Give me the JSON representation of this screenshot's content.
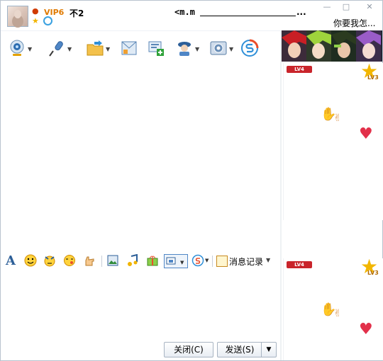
{
  "header": {
    "vip_label": "VIP6",
    "nickname": "不2",
    "remark_prefix": "<m.m",
    "remark_suffix": "...",
    "status_text": "你要我怎..."
  },
  "window_controls": [
    "—",
    "□",
    "✕"
  ],
  "toolbar": {
    "buttons": [
      {
        "name": "video-call",
        "icon": "webcam-icon",
        "has_dropdown": true
      },
      {
        "name": "voice-call",
        "icon": "microphone-icon",
        "has_dropdown": true
      },
      {
        "name": "send-file",
        "icon": "folder-send-icon",
        "has_dropdown": true
      },
      {
        "name": "send-sms",
        "icon": "sms-icon",
        "has_dropdown": false
      },
      {
        "name": "create-discussion",
        "icon": "group-add-icon",
        "has_dropdown": false
      },
      {
        "name": "remote-assist",
        "icon": "assist-icon",
        "has_dropdown": false
      },
      {
        "name": "apps",
        "icon": "apps-icon",
        "has_dropdown": true
      },
      {
        "name": "soso",
        "icon": "soso-icon",
        "has_dropdown": false
      }
    ]
  },
  "input_toolbar": {
    "font_label": "A",
    "history_label": "消息记录"
  },
  "buttons": {
    "close": "关闭(C)",
    "send": "发送(S)",
    "send_arrow": "▼"
  },
  "right_panel": {
    "badge_text": "LV4",
    "level_text": "LV3"
  },
  "colors": {
    "accent": "#3aa1e0",
    "vip": "#e07a00",
    "badge": "#c9242b"
  }
}
